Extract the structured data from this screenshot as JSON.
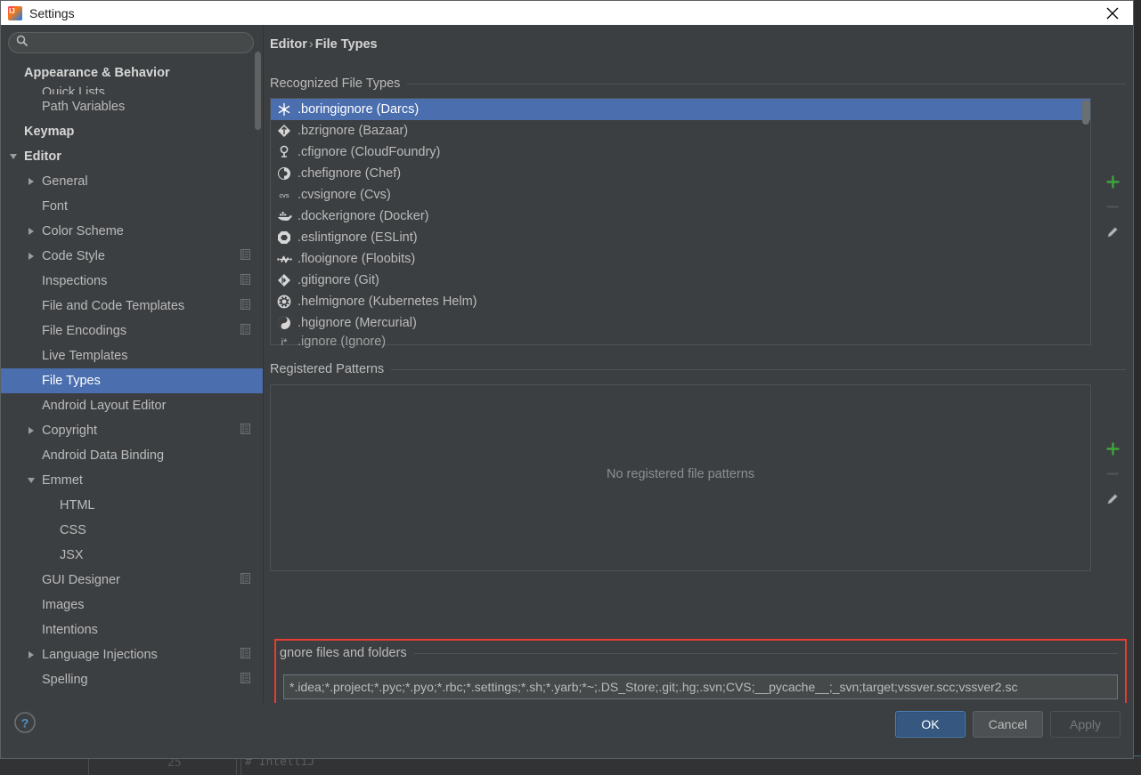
{
  "window": {
    "title": "Settings",
    "app_icon": "intellij-logo-icon",
    "close_icon": "close-icon"
  },
  "sidebar": {
    "search": {
      "value": "",
      "placeholder": "",
      "icon": "search-icon"
    },
    "items": [
      {
        "label": "Appearance & Behavior",
        "indent": 0,
        "bold": true,
        "arrow": "none",
        "selected": false,
        "copy": false
      },
      {
        "label": "Quick Lists",
        "indent": 1,
        "bold": false,
        "arrow": "none",
        "selected": false,
        "copy": false,
        "clipped": true
      },
      {
        "label": "Path Variables",
        "indent": 1,
        "bold": false,
        "arrow": "none",
        "selected": false,
        "copy": false
      },
      {
        "label": "Keymap",
        "indent": 0,
        "bold": true,
        "arrow": "none",
        "selected": false,
        "copy": false
      },
      {
        "label": "Editor",
        "indent": 0,
        "bold": true,
        "arrow": "down",
        "selected": false,
        "copy": false
      },
      {
        "label": "General",
        "indent": 1,
        "bold": false,
        "arrow": "right",
        "selected": false,
        "copy": false
      },
      {
        "label": "Font",
        "indent": 1,
        "bold": false,
        "arrow": "none",
        "selected": false,
        "copy": false
      },
      {
        "label": "Color Scheme",
        "indent": 1,
        "bold": false,
        "arrow": "right",
        "selected": false,
        "copy": false
      },
      {
        "label": "Code Style",
        "indent": 1,
        "bold": false,
        "arrow": "right",
        "selected": false,
        "copy": true
      },
      {
        "label": "Inspections",
        "indent": 1,
        "bold": false,
        "arrow": "none",
        "selected": false,
        "copy": true
      },
      {
        "label": "File and Code Templates",
        "indent": 1,
        "bold": false,
        "arrow": "none",
        "selected": false,
        "copy": true
      },
      {
        "label": "File Encodings",
        "indent": 1,
        "bold": false,
        "arrow": "none",
        "selected": false,
        "copy": true
      },
      {
        "label": "Live Templates",
        "indent": 1,
        "bold": false,
        "arrow": "none",
        "selected": false,
        "copy": false
      },
      {
        "label": "File Types",
        "indent": 1,
        "bold": false,
        "arrow": "none",
        "selected": true,
        "copy": false
      },
      {
        "label": "Android Layout Editor",
        "indent": 1,
        "bold": false,
        "arrow": "none",
        "selected": false,
        "copy": false
      },
      {
        "label": "Copyright",
        "indent": 1,
        "bold": false,
        "arrow": "right",
        "selected": false,
        "copy": true
      },
      {
        "label": "Android Data Binding",
        "indent": 1,
        "bold": false,
        "arrow": "none",
        "selected": false,
        "copy": false
      },
      {
        "label": "Emmet",
        "indent": 1,
        "bold": false,
        "arrow": "down",
        "selected": false,
        "copy": false
      },
      {
        "label": "HTML",
        "indent": 2,
        "bold": false,
        "arrow": "none",
        "selected": false,
        "copy": false
      },
      {
        "label": "CSS",
        "indent": 2,
        "bold": false,
        "arrow": "none",
        "selected": false,
        "copy": false
      },
      {
        "label": "JSX",
        "indent": 2,
        "bold": false,
        "arrow": "none",
        "selected": false,
        "copy": false
      },
      {
        "label": "GUI Designer",
        "indent": 1,
        "bold": false,
        "arrow": "none",
        "selected": false,
        "copy": true
      },
      {
        "label": "Images",
        "indent": 1,
        "bold": false,
        "arrow": "none",
        "selected": false,
        "copy": false
      },
      {
        "label": "Intentions",
        "indent": 1,
        "bold": false,
        "arrow": "none",
        "selected": false,
        "copy": false
      },
      {
        "label": "Language Injections",
        "indent": 1,
        "bold": false,
        "arrow": "right",
        "selected": false,
        "copy": true
      },
      {
        "label": "Spelling",
        "indent": 1,
        "bold": false,
        "arrow": "none",
        "selected": false,
        "copy": true
      }
    ]
  },
  "main": {
    "breadcrumb": {
      "parent": "Editor",
      "separator": "›",
      "current": "File Types"
    },
    "recognized": {
      "title": "Recognized File Types",
      "rows": [
        {
          "icon": "darcs-snowflake-icon",
          "label": ".boringignore (Darcs)",
          "selected": true
        },
        {
          "icon": "bazaar-diamond-icon",
          "label": ".bzrignore (Bazaar)",
          "selected": false
        },
        {
          "icon": "cloudfoundry-icon",
          "label": ".cfignore (CloudFoundry)",
          "selected": false
        },
        {
          "icon": "chef-icon",
          "label": ".chefignore (Chef)",
          "selected": false
        },
        {
          "icon": "cvs-text-icon",
          "label": ".cvsignore (Cvs)",
          "selected": false
        },
        {
          "icon": "docker-whale-icon",
          "label": ".dockerignore (Docker)",
          "selected": false
        },
        {
          "icon": "eslint-octagon-icon",
          "label": ".eslintignore (ESLint)",
          "selected": false
        },
        {
          "icon": "floobits-icon",
          "label": ".flooignore (Floobits)",
          "selected": false
        },
        {
          "icon": "git-diamond-icon",
          "label": ".gitignore (Git)",
          "selected": false
        },
        {
          "icon": "helm-wheel-icon",
          "label": ".helmignore (Kubernetes Helm)",
          "selected": false
        },
        {
          "icon": "mercurial-icon",
          "label": ".hgignore (Mercurial)",
          "selected": false
        },
        {
          "icon": "ignore-icon",
          "label": ".ignore (Ignore)",
          "selected": false
        }
      ],
      "tools": [
        {
          "name": "add-file-type-button",
          "glyph": "plus",
          "enabled": true
        },
        {
          "name": "remove-file-type-button",
          "glyph": "minus",
          "enabled": false
        },
        {
          "name": "edit-file-type-button",
          "glyph": "pencil",
          "enabled": true
        }
      ]
    },
    "registered": {
      "title": "Registered Patterns",
      "empty_message": "No registered file patterns",
      "tools": [
        {
          "name": "add-pattern-button",
          "glyph": "plus",
          "enabled": true
        },
        {
          "name": "remove-pattern-button",
          "glyph": "minus",
          "enabled": false
        },
        {
          "name": "edit-pattern-button",
          "glyph": "pencil",
          "enabled": true
        }
      ]
    },
    "ignore": {
      "label": "gnore files and folders",
      "value": "*.idea;*.project;*.pyc;*.pyo;*.rbc;*.settings;*.sh;*.yarb;*~;.DS_Store;.git;.hg;.svn;CVS;__pycache__;_svn;target;vssver.scc;vssver2.sc",
      "placeholder": ""
    }
  },
  "footer": {
    "help_icon": "help-question-icon",
    "buttons": [
      {
        "label": "OK",
        "style": "primary"
      },
      {
        "label": "Cancel",
        "style": "normal"
      },
      {
        "label": "Apply",
        "style": "disabled"
      }
    ]
  },
  "backdrop": {
    "line_number": "25",
    "code_text": "# IntelliJ"
  },
  "colors": {
    "accent_selection": "#4b6eaf",
    "highlight_border": "#e83b33",
    "panel_bg": "#3c3f41",
    "primary_button": "#365880"
  }
}
